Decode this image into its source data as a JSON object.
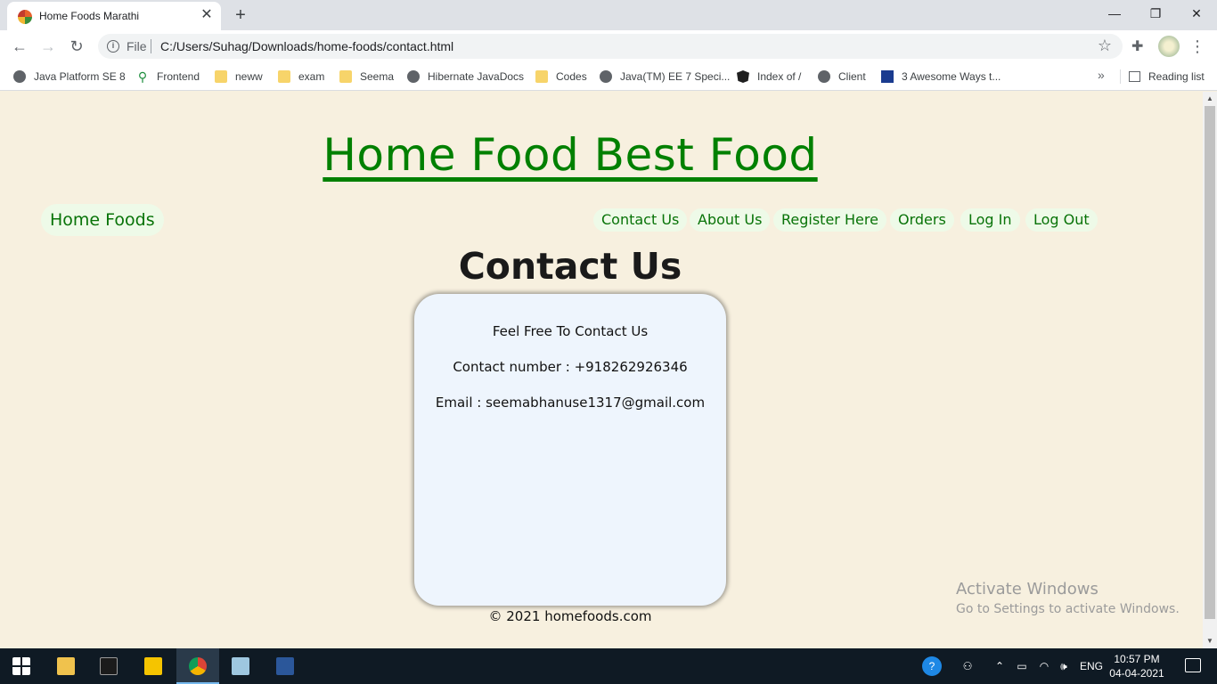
{
  "browser": {
    "tab": {
      "title": "Home Foods Marathi",
      "close_glyph": "✕"
    },
    "new_tab_glyph": "+",
    "window_controls": [
      "—",
      "❐",
      "✕"
    ],
    "toolbar": {
      "back_glyph": "←",
      "forward_glyph": "→",
      "reload_glyph": "↻",
      "info_glyph": "i",
      "scheme": "File",
      "url": "C:/Users/Suhag/Downloads/home-foods/contact.html",
      "star_glyph": "☆",
      "extensions_glyph": "✚",
      "menu_glyph": "⋮"
    },
    "bookmarks": [
      {
        "label": "Java Platform SE 8",
        "icon": "globe-icon"
      },
      {
        "label": "Frontend",
        "icon": "pin-icon"
      },
      {
        "label": "neww",
        "icon": "folder-icon"
      },
      {
        "label": "exam",
        "icon": "folder-icon"
      },
      {
        "label": "Seema",
        "icon": "folder-icon"
      },
      {
        "label": "Hibernate JavaDocs",
        "icon": "globe-icon"
      },
      {
        "label": "Codes",
        "icon": "folder-icon"
      },
      {
        "label": "Java(TM) EE 7 Speci...",
        "icon": "globe-icon"
      },
      {
        "label": "Index of /",
        "icon": "angular-icon"
      },
      {
        "label": "Client",
        "icon": "globe-icon"
      },
      {
        "label": "3 Awesome Ways t...",
        "icon": "site-icon"
      }
    ],
    "bookmarks_overflow_glyph": "»",
    "reading_list": "Reading list"
  },
  "page": {
    "site_title": "Home Food Best Food",
    "brand": "Home Foods",
    "nav": [
      "Contact Us",
      "About Us",
      "Register Here",
      "Orders",
      "Log In",
      "Log Out"
    ],
    "heading": "Contact Us",
    "card": {
      "intro": "Feel Free To Contact Us",
      "phone": "Contact number : +918262926346",
      "email": "Email : seemabhanuse1317@gmail.com"
    },
    "footer": "© 2021 homefoods.com",
    "watermark": {
      "title": "Activate Windows",
      "subtitle": "Go to Settings to activate Windows."
    }
  },
  "taskbar": {
    "apps": [
      "start-icon",
      "file-explorer-icon",
      "terminal-icon",
      "player-icon",
      "chrome-icon",
      "app-icon",
      "word-icon"
    ],
    "tray": {
      "language": "ENG",
      "time": "10:57 PM",
      "date": "04-04-2021"
    }
  },
  "colors": {
    "page_bg": "#f7f0df",
    "title_green": "#008000",
    "pill_bg": "#eefae8",
    "card_bg": "#eef5fd"
  }
}
